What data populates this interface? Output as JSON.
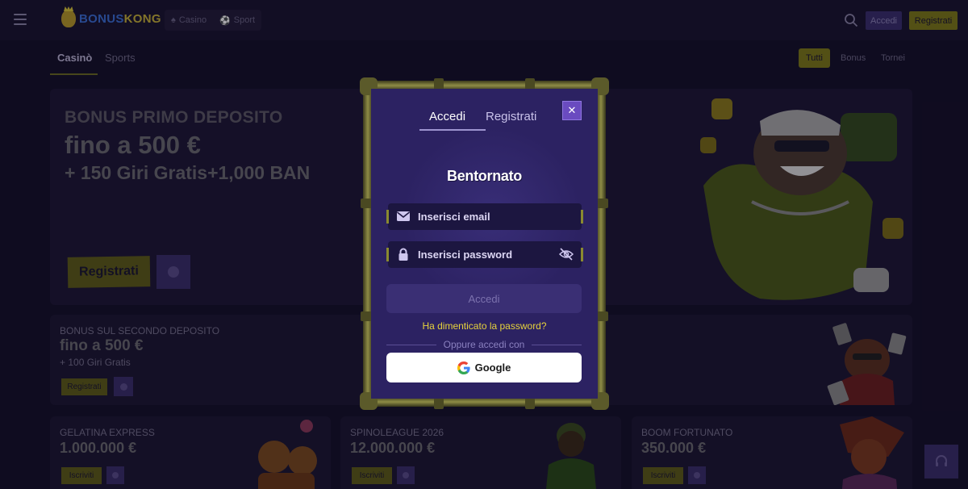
{
  "header": {
    "brand_a": "BONUS",
    "brand_b": "KONG",
    "nav": [
      {
        "label": "Casino",
        "icon": "slot-icon"
      },
      {
        "label": "Sport",
        "icon": "ball-icon"
      }
    ],
    "login_label": "Accedi",
    "register_label": "Registrati"
  },
  "subnav": {
    "tabs": [
      {
        "label": "Casinò",
        "active": true
      },
      {
        "label": "Sports",
        "active": false
      }
    ],
    "filters": [
      {
        "label": "Tutti",
        "active": true
      },
      {
        "label": "Bonus",
        "active": false
      },
      {
        "label": "Tornei",
        "active": false
      }
    ]
  },
  "hero": {
    "line1": "BONUS PRIMO DEPOSITO",
    "line2": "fino a 500 €",
    "line3": "+ 150 Giri Gratis+1,000 BAN",
    "cta": "Registrati"
  },
  "second_bonus": {
    "title": "BONUS SUL SECONDO DEPOSITO",
    "amount": "fino a 500 €",
    "subtitle": "+ 100 Giri Gratis",
    "cta": "Registrati"
  },
  "tournaments": [
    {
      "title": "GELATINA EXPRESS",
      "amount": "1.000.000 €",
      "cta": "Iscriviti"
    },
    {
      "title": "SPINOLEAGUE 2026",
      "amount": "12.000.000 €",
      "cta": "Iscriviti"
    },
    {
      "title": "BOOM FORTUNATO",
      "amount": "350.000 €",
      "cta": "Iscriviti"
    }
  ],
  "modal": {
    "tab_login": "Accedi",
    "tab_register": "Registrati",
    "close": "✕",
    "title": "Bentornato",
    "email_placeholder": "Inserisci email",
    "password_placeholder": "Inserisci password",
    "submit": "Accedi",
    "forgot": "Ha dimenticato la password?",
    "or_text": "Oppure accedi con",
    "google": "Google"
  },
  "colors": {
    "accent_yellow": "#e6d23c",
    "modal_bg": "#2c2262",
    "page_bg": "#15112a"
  }
}
